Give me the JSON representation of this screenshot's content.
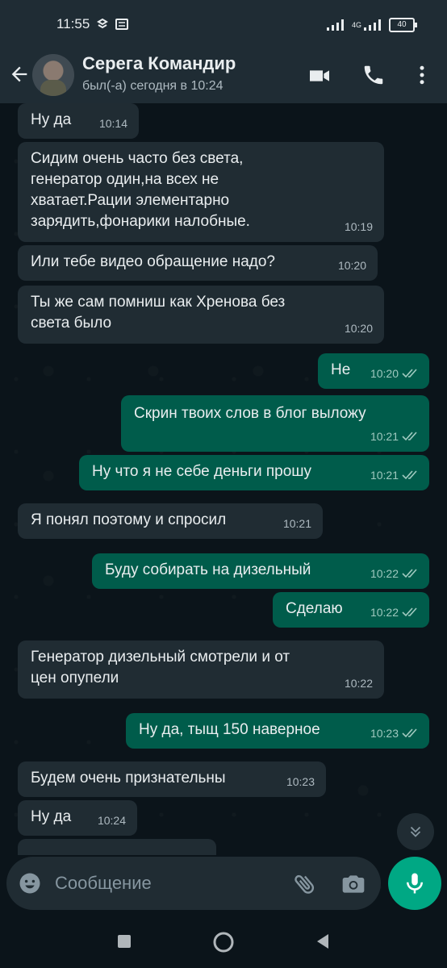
{
  "status_bar": {
    "time": "11:55",
    "network": "4G",
    "battery": "40"
  },
  "header": {
    "contact_name": "Серега Командир",
    "last_seen": "был(-а) сегодня в 10:24"
  },
  "messages": [
    {
      "dir": "in",
      "text": "Ну да",
      "time": "10:14"
    },
    {
      "dir": "in",
      "text": "Сидим очень часто без света,\nгенератор один,на всех не\nхватает.Рации элементарно\nзарядить,фонарики налобные.",
      "time": "10:19"
    },
    {
      "dir": "in",
      "text": "Или тебе видео обращение надо?",
      "time": "10:20"
    },
    {
      "dir": "in",
      "text": "Ты же сам помниш как Хренова без\nсвета было",
      "time": "10:20"
    },
    {
      "dir": "out",
      "text": "Не",
      "time": "10:20"
    },
    {
      "dir": "out",
      "text": "Скрин твоих слов в блог выложу",
      "time": "10:21"
    },
    {
      "dir": "out",
      "text": "Ну что я не себе деньги прошу",
      "time": "10:21"
    },
    {
      "dir": "in",
      "text": "Я понял поэтому и спросил",
      "time": "10:21"
    },
    {
      "dir": "out",
      "text": "Буду собирать на дизельный",
      "time": "10:22"
    },
    {
      "dir": "out",
      "text": "Сделаю",
      "time": "10:22"
    },
    {
      "dir": "in",
      "text": "Генератор дизельный смотрели и от\nцен опупели",
      "time": "10:22"
    },
    {
      "dir": "out",
      "text": "Ну да, тыщ 150 наверное",
      "time": "10:23"
    },
    {
      "dir": "in",
      "text": "Будем очень признательны",
      "time": "10:23"
    },
    {
      "dir": "in",
      "text": "Ну да",
      "time": "10:24"
    }
  ],
  "composer": {
    "placeholder": "Сообщение"
  },
  "icons": {
    "back": "arrow-left-icon",
    "video": "video-call-icon",
    "call": "phone-icon",
    "menu": "more-vert-icon",
    "emoji": "emoji-icon",
    "attach": "paperclip-icon",
    "camera": "camera-icon",
    "mic": "mic-icon",
    "scroll": "double-chevron-down-icon",
    "read": "double-check-icon"
  },
  "colors": {
    "background": "#0b141a",
    "header": "#1f2c34",
    "incoming": "#202c33",
    "outgoing": "#005c4b",
    "accent": "#00a884"
  }
}
